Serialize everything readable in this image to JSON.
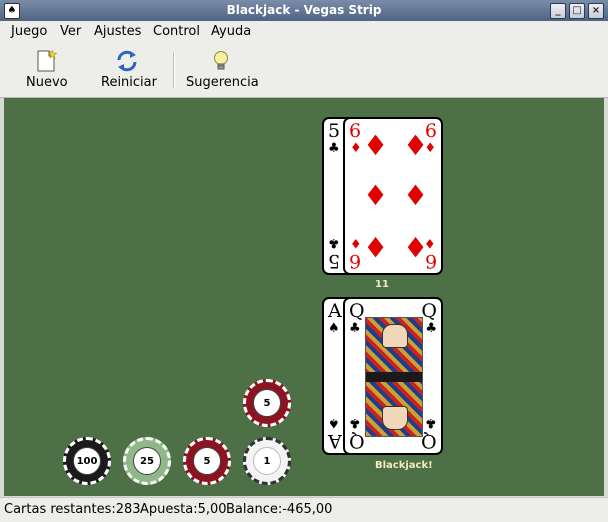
{
  "window": {
    "title": "Blackjack - Vegas Strip",
    "app_icon": "cards-icon",
    "controls": {
      "minimize": "_",
      "maximize": "□",
      "close": "×"
    }
  },
  "menubar": {
    "items": [
      {
        "label": "Juego"
      },
      {
        "label": "Ver"
      },
      {
        "label": "Ajustes"
      },
      {
        "label": "Control"
      },
      {
        "label": "Ayuda"
      }
    ]
  },
  "toolbar": {
    "buttons": [
      {
        "label": "Nuevo",
        "icon": "new-document-icon"
      },
      {
        "label": "Reiniciar",
        "icon": "refresh-icon"
      },
      {
        "label": "Sugerencia",
        "icon": "lightbulb-icon"
      }
    ]
  },
  "table": {
    "colors": {
      "felt": "#4d7046",
      "label": "#f2ecc0"
    },
    "dealer_hand": {
      "cards": [
        {
          "rank": "5",
          "suit": "♣",
          "color": "black"
        },
        {
          "rank": "6",
          "suit": "♦",
          "color": "red"
        }
      ],
      "total_label": "11"
    },
    "player_hand": {
      "cards": [
        {
          "rank": "A",
          "suit": "♠",
          "color": "black"
        },
        {
          "rank": "Q",
          "suit": "♣",
          "color": "black"
        }
      ],
      "result_label": "Blackjack!"
    },
    "chips": {
      "stack": [
        {
          "value": "100",
          "color": "#1a1a1a"
        },
        {
          "value": "25",
          "color": "#8fb888"
        },
        {
          "value": "5",
          "color": "#8c1420"
        },
        {
          "value": "1",
          "color": "#f4f4f4"
        }
      ],
      "bet": {
        "value": "5",
        "color": "#8c1420"
      }
    }
  },
  "statusbar": {
    "cards_remaining": "Cartas restantes:283",
    "bet": "Apuesta:5,00",
    "balance": "Balance:-465,00"
  }
}
